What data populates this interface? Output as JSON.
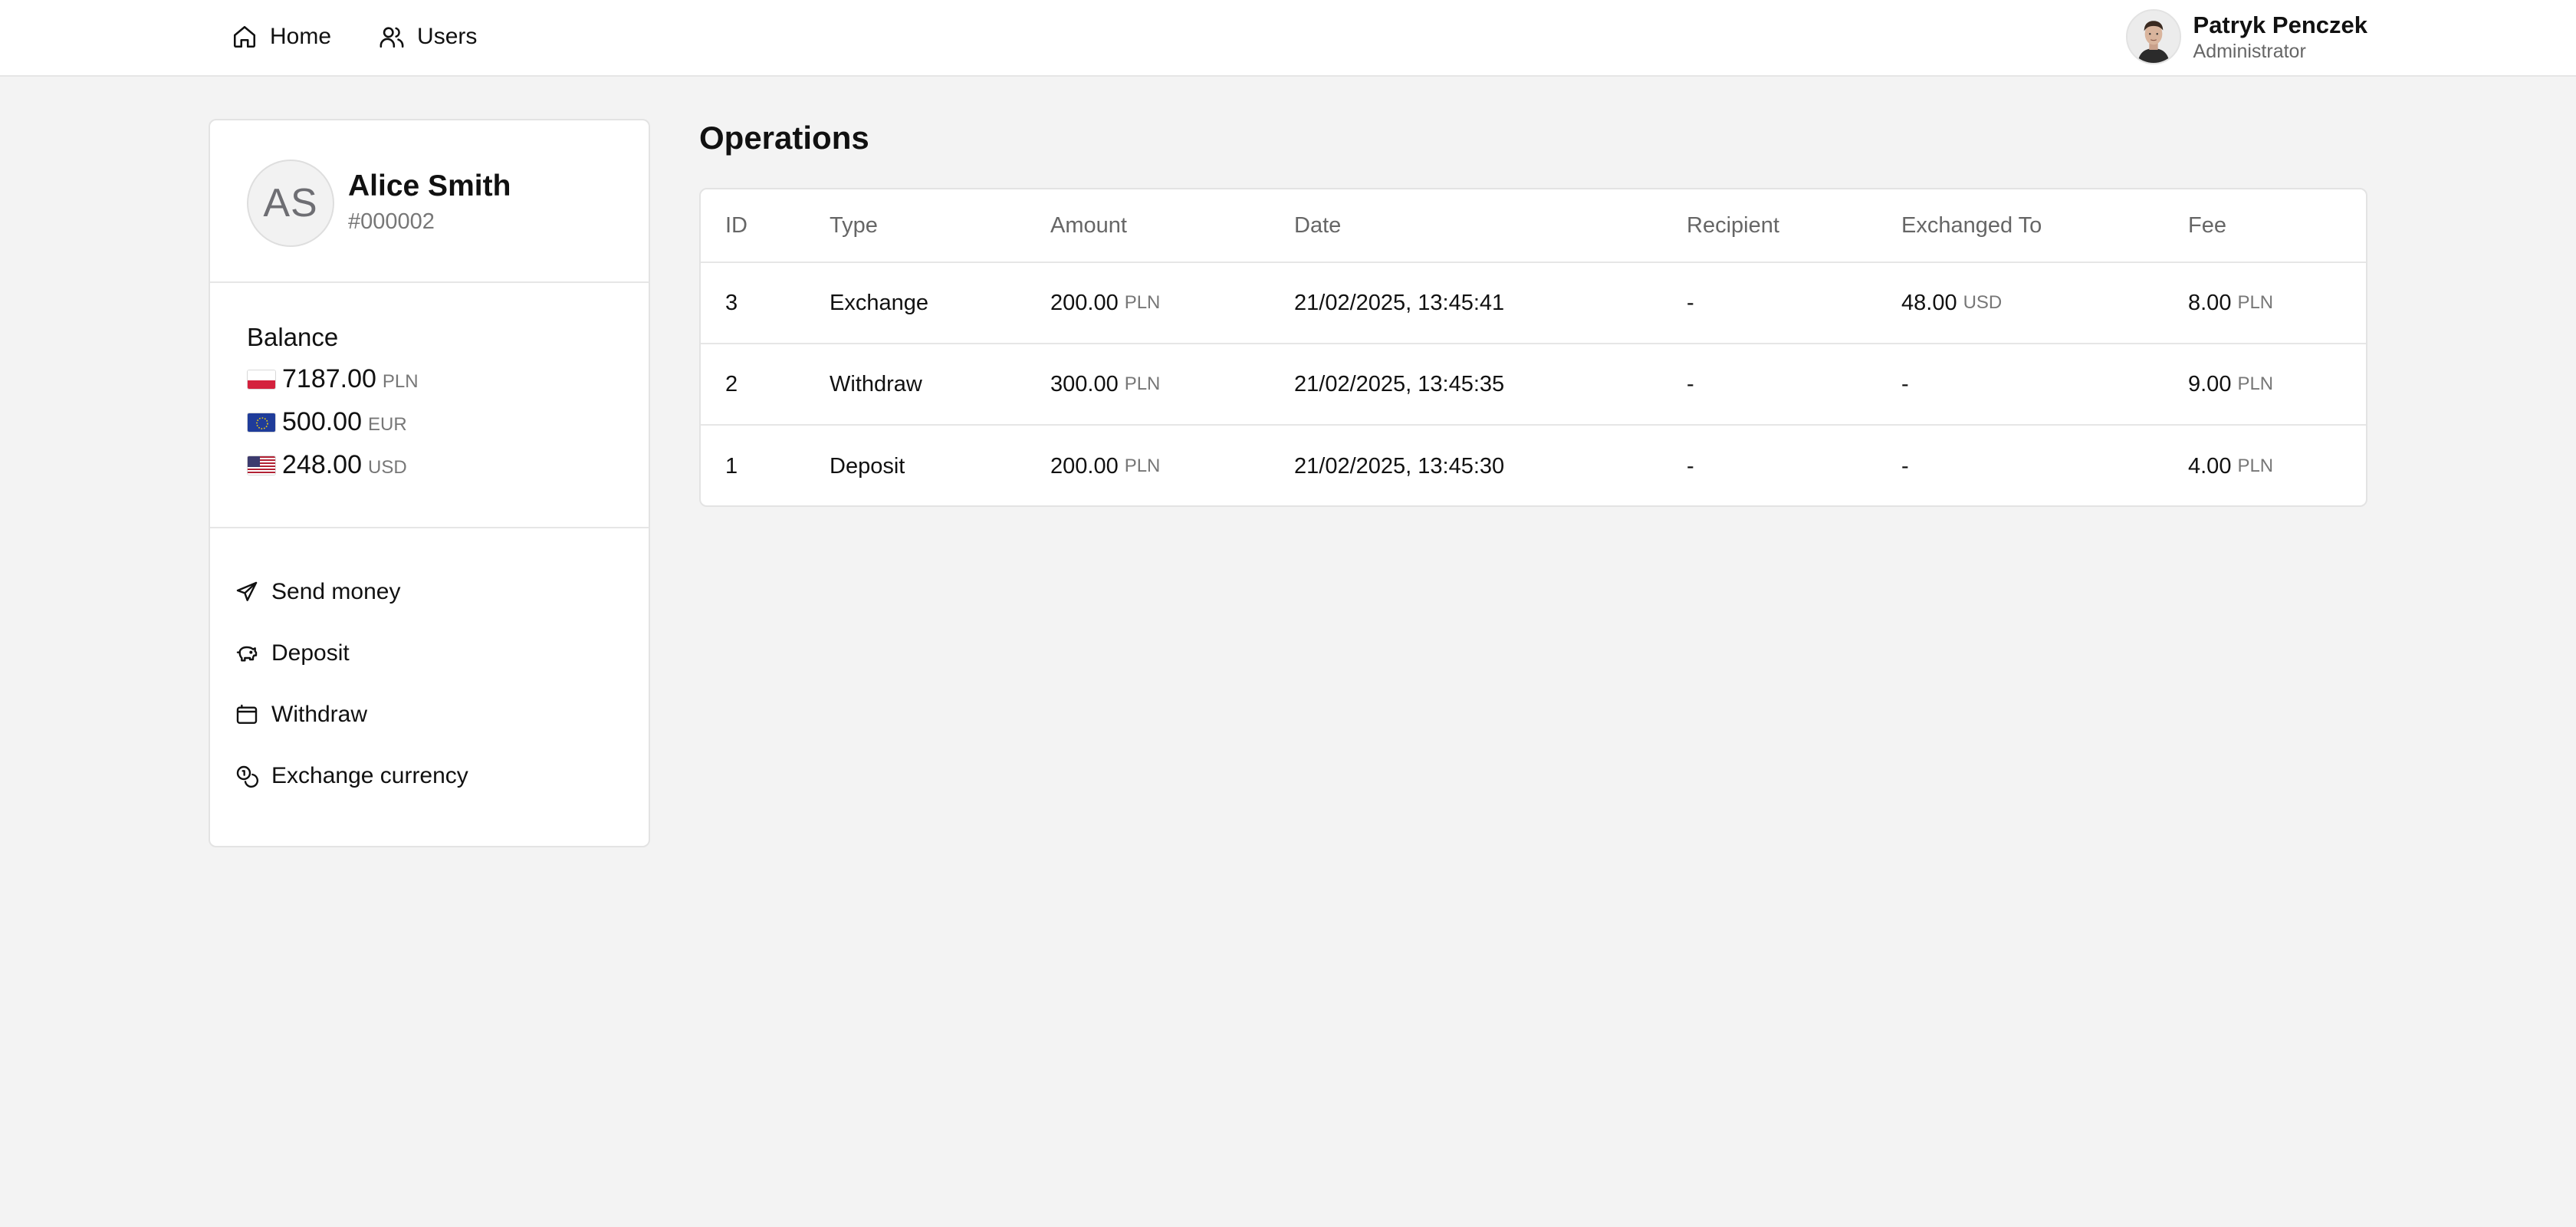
{
  "nav": {
    "items": [
      {
        "label": "Home",
        "icon": "home-icon"
      },
      {
        "label": "Users",
        "icon": "users-icon"
      }
    ]
  },
  "user": {
    "name": "Patryk Penczek",
    "role": "Administrator",
    "avatar": "user-photo"
  },
  "client": {
    "initials": "AS",
    "name": "Alice Smith",
    "id": "#000002"
  },
  "balance": {
    "title": "Balance",
    "items": [
      {
        "amount": "7187.00",
        "currency": "PLN",
        "flag": "poland-flag-icon"
      },
      {
        "amount": "500.00",
        "currency": "EUR",
        "flag": "eu-flag-icon"
      },
      {
        "amount": "248.00",
        "currency": "USD",
        "flag": "us-flag-icon"
      }
    ]
  },
  "actions": [
    {
      "label": "Send money",
      "icon": "send-icon"
    },
    {
      "label": "Deposit",
      "icon": "piggy-bank-icon"
    },
    {
      "label": "Withdraw",
      "icon": "wallet-icon"
    },
    {
      "label": "Exchange currency",
      "icon": "coins-icon"
    }
  ],
  "operations": {
    "title": "Operations",
    "columns": [
      "ID",
      "Type",
      "Amount",
      "Date",
      "Recipient",
      "Exchanged To",
      "Fee"
    ],
    "rows": [
      {
        "id": "3",
        "type": "Exchange",
        "amount": "200.00",
        "amount_cur": "PLN",
        "date": "21/02/2025, 13:45:41",
        "recipient": "-",
        "exchanged": "48.00",
        "exchanged_cur": "USD",
        "fee": "8.00",
        "fee_cur": "PLN"
      },
      {
        "id": "2",
        "type": "Withdraw",
        "amount": "300.00",
        "amount_cur": "PLN",
        "date": "21/02/2025, 13:45:35",
        "recipient": "-",
        "exchanged": "-",
        "exchanged_cur": "",
        "fee": "9.00",
        "fee_cur": "PLN"
      },
      {
        "id": "1",
        "type": "Deposit",
        "amount": "200.00",
        "amount_cur": "PLN",
        "date": "21/02/2025, 13:45:30",
        "recipient": "-",
        "exchanged": "-",
        "exchanged_cur": "",
        "fee": "4.00",
        "fee_cur": "PLN"
      }
    ]
  }
}
